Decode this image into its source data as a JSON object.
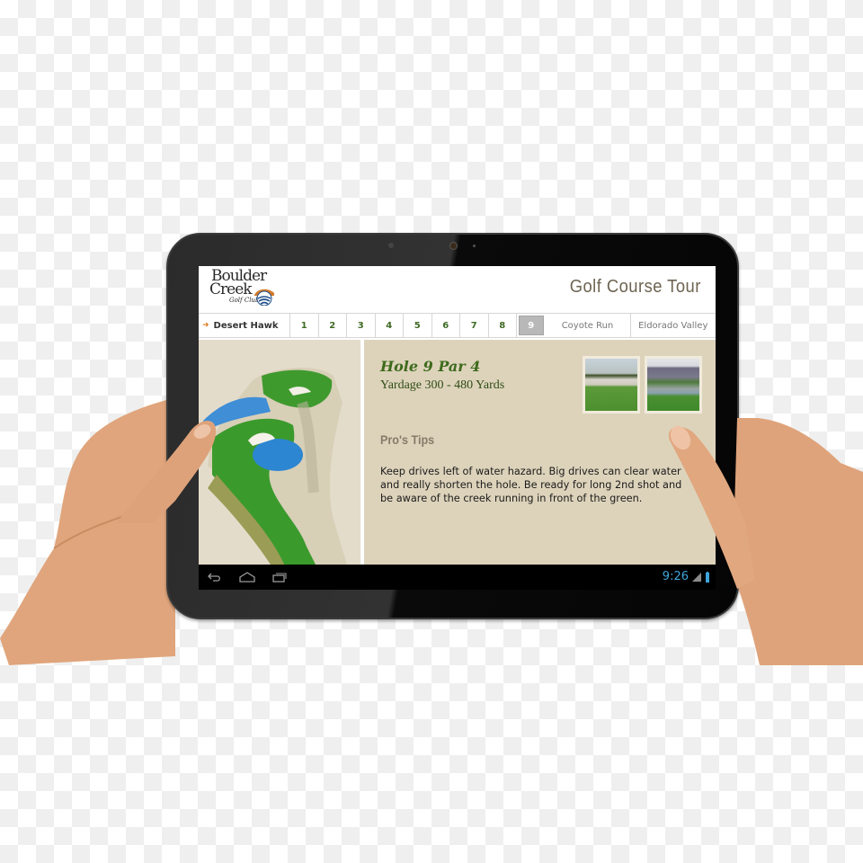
{
  "app": {
    "logo": {
      "line1": "Boulder",
      "line2": "Creek",
      "line3": "Golf Club"
    },
    "title": "Golf Course Tour"
  },
  "nav": {
    "current_course": "Desert Hawk",
    "holes": [
      "1",
      "2",
      "3",
      "4",
      "5",
      "6",
      "7",
      "8",
      "9"
    ],
    "active_hole": "9",
    "other_courses": [
      "Coyote Run",
      "Eldorado Valley"
    ]
  },
  "hole": {
    "title": "Hole 9 Par 4",
    "yardage": "Yardage 300 - 480 Yards",
    "tips_heading": "Pro's Tips",
    "tips_text": "Keep drives left of water hazard. Big drives can clear water and really shorten the hole. Be ready for long 2nd shot and be aware of the creek running in front of the green.",
    "photos": [
      "fairway-bunker-photo",
      "green-water-photo"
    ]
  },
  "system_bar": {
    "time": "9:26",
    "icons": [
      "back-icon",
      "home-icon",
      "recent-apps-icon",
      "signal-icon",
      "battery-icon"
    ]
  },
  "colors": {
    "accent_green": "#3d6a1c",
    "content_bg": "#ddd3bb",
    "clock_blue": "#3fa4d9",
    "nav_arrow": "#e07b1f"
  }
}
